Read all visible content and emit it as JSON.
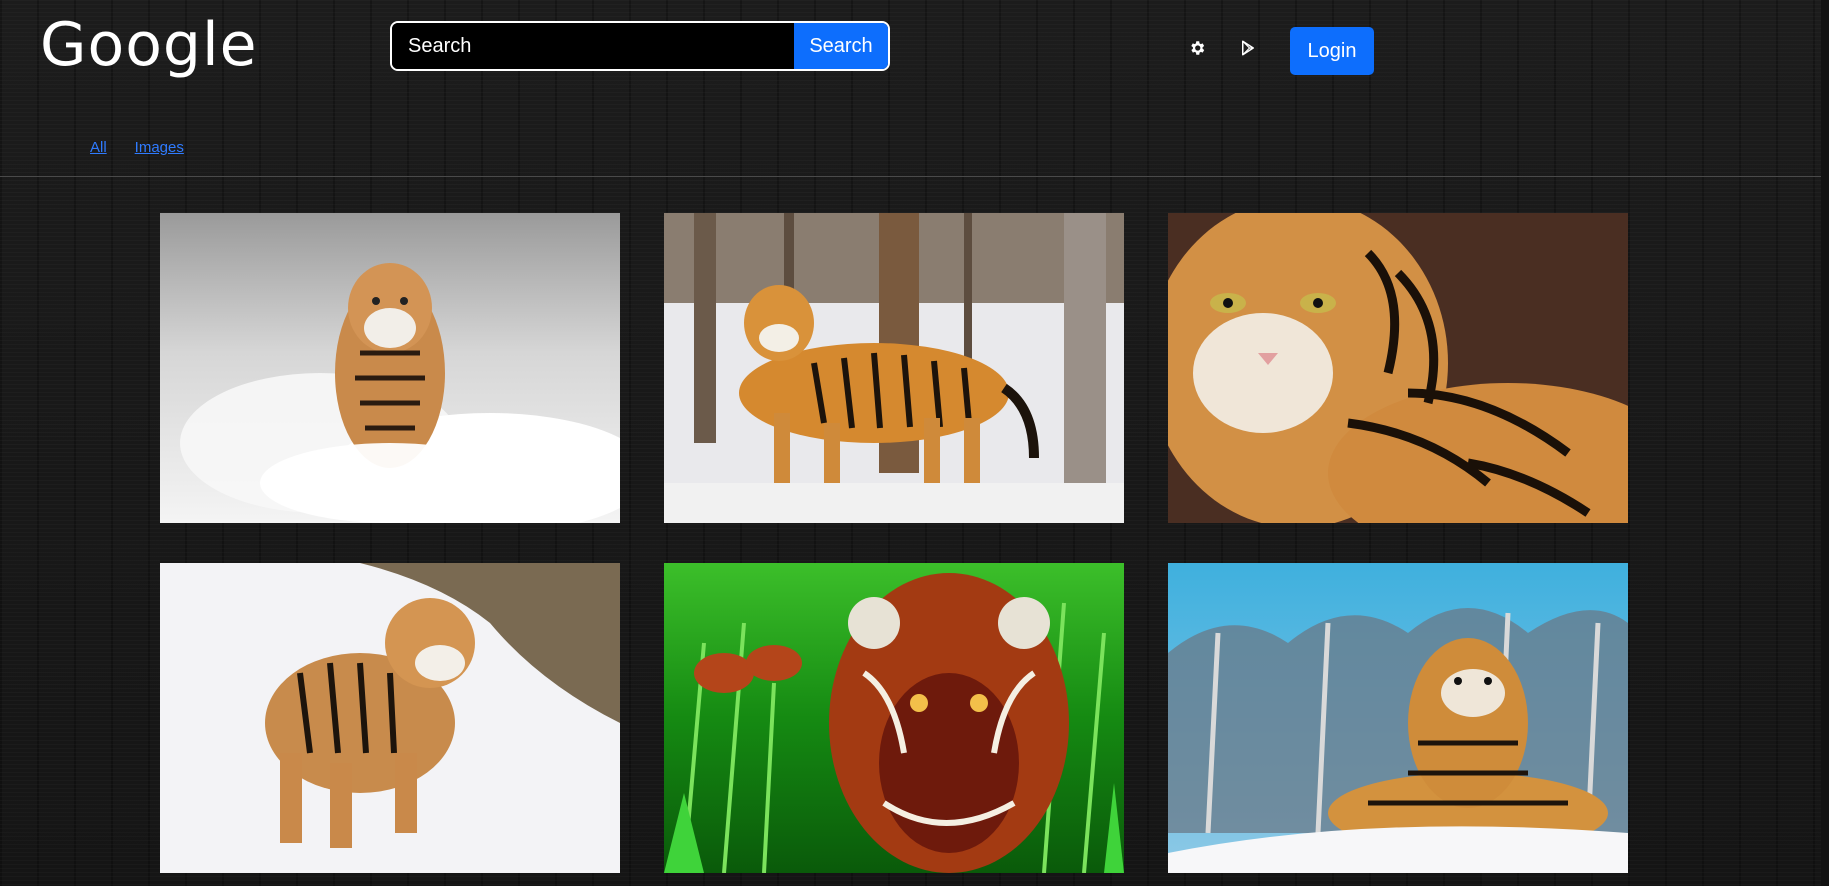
{
  "header": {
    "logo": "Google",
    "search": {
      "placeholder": "Search",
      "value": "",
      "button_label": "Search"
    },
    "icons": [
      "gear-icon",
      "play-store-icon"
    ],
    "login_label": "Login"
  },
  "tabs": [
    {
      "label": "All"
    },
    {
      "label": "Images"
    }
  ],
  "colors": {
    "accent": "#0d6efd",
    "link": "#2f7bff",
    "background": "#161616"
  },
  "results": {
    "images": [
      {
        "subject": "tiger-running-in-snow"
      },
      {
        "subject": "tiger-standing-in-snowy-forest"
      },
      {
        "subject": "tiger-face-closeup"
      },
      {
        "subject": "tiger-walking-in-snow"
      },
      {
        "subject": "tiger-digital-art-green-grass"
      },
      {
        "subject": "tiger-lying-in-snow-blue-sky"
      }
    ]
  }
}
